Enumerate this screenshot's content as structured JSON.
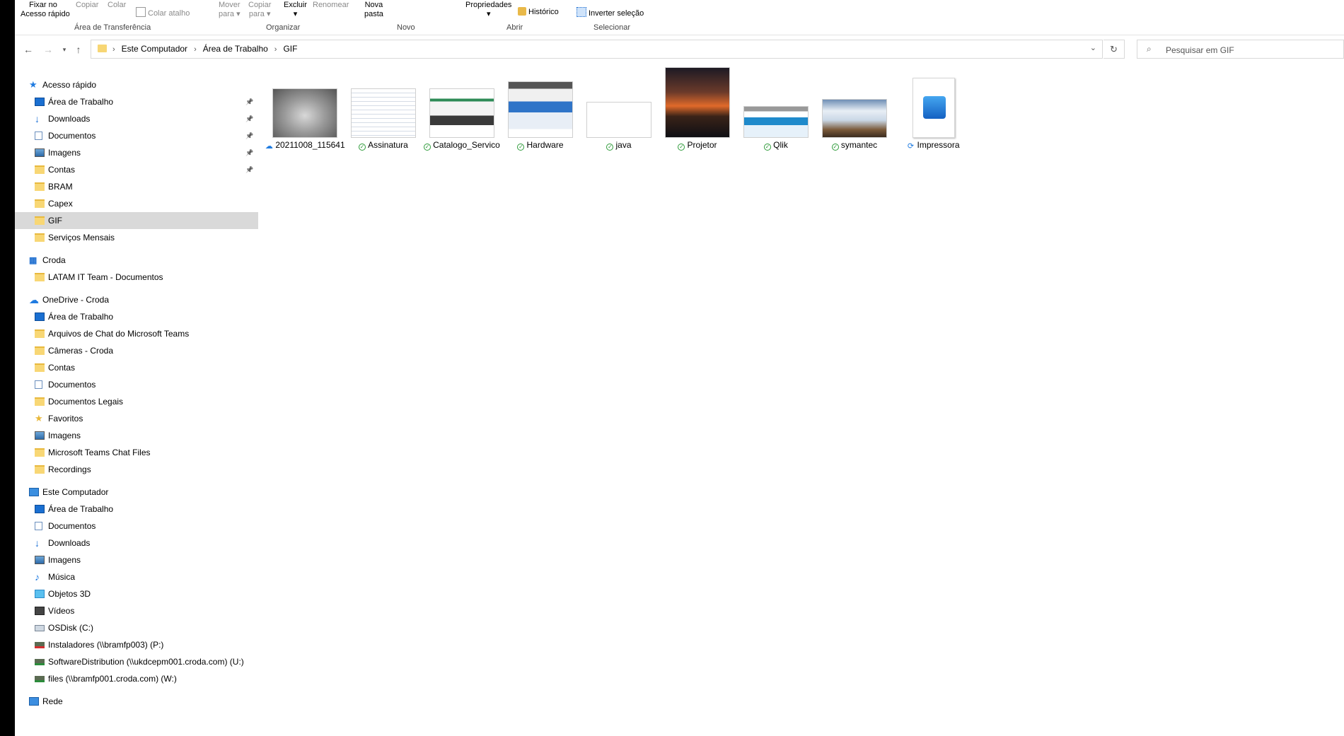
{
  "ribbon": {
    "buttons": [
      {
        "l1": "Fixar no",
        "l2": "Acesso rápido"
      },
      {
        "l1": "Copiar",
        "l2": ""
      },
      {
        "l1": "Colar",
        "l2": ""
      },
      {
        "l1": "Colar atalho",
        "l2": ""
      },
      {
        "l1": "Mover",
        "l2": "para"
      },
      {
        "l1": "Copiar",
        "l2": "para"
      },
      {
        "l1": "Excluir",
        "l2": ""
      },
      {
        "l1": "Renomear",
        "l2": ""
      },
      {
        "l1": "Nova",
        "l2": "pasta"
      },
      {
        "l1": "Propriedades",
        "l2": ""
      },
      {
        "l1": "Histórico",
        "l2": ""
      },
      {
        "l1": "Inverter seleção",
        "l2": ""
      }
    ],
    "groups": [
      "Área de Transferência",
      "Organizar",
      "Novo",
      "Abrir",
      "Selecionar"
    ]
  },
  "address": {
    "crumbs": [
      "Este Computador",
      "Área de Trabalho",
      "GIF"
    ]
  },
  "search": {
    "placeholder": "Pesquisar em GIF"
  },
  "nav": {
    "quick_access": "Acesso rápido",
    "quick_items": [
      "Área de Trabalho",
      "Downloads",
      "Documentos",
      "Imagens",
      "Contas",
      "BRAM",
      "Capex",
      "GIF",
      "Serviços Mensais"
    ],
    "croda": "Croda",
    "croda_items": [
      "LATAM IT Team - Documentos"
    ],
    "onedrive": "OneDrive - Croda",
    "onedrive_items": [
      "Área de Trabalho",
      "Arquivos de Chat do Microsoft Teams",
      "Câmeras - Croda",
      "Contas",
      "Documentos",
      "Documentos Legais",
      "Favoritos",
      "Imagens",
      "Microsoft Teams Chat Files",
      "Recordings"
    ],
    "this_pc": "Este Computador",
    "pc_items": [
      "Área de Trabalho",
      "Documentos",
      "Downloads",
      "Imagens",
      "Música",
      "Objetos 3D",
      "Vídeos",
      "OSDisk (C:)",
      "Instaladores (\\\\bramfp003) (P:)",
      "SoftwareDistribution (\\\\ukdcepm001.croda.com) (U:)",
      "files (\\\\bramfp001.croda.com) (W:)"
    ],
    "network": "Rede"
  },
  "files": [
    {
      "name": "20211008_115641",
      "status": "cloud"
    },
    {
      "name": "Assinatura",
      "status": "ok"
    },
    {
      "name": "Catalogo_Servico",
      "status": "ok"
    },
    {
      "name": "Hardware",
      "status": "ok"
    },
    {
      "name": "java",
      "status": "ok"
    },
    {
      "name": "Projetor",
      "status": "ok"
    },
    {
      "name": "Qlik",
      "status": "ok"
    },
    {
      "name": "symantec",
      "status": "ok"
    },
    {
      "name": "Impressora",
      "status": "sync"
    }
  ]
}
